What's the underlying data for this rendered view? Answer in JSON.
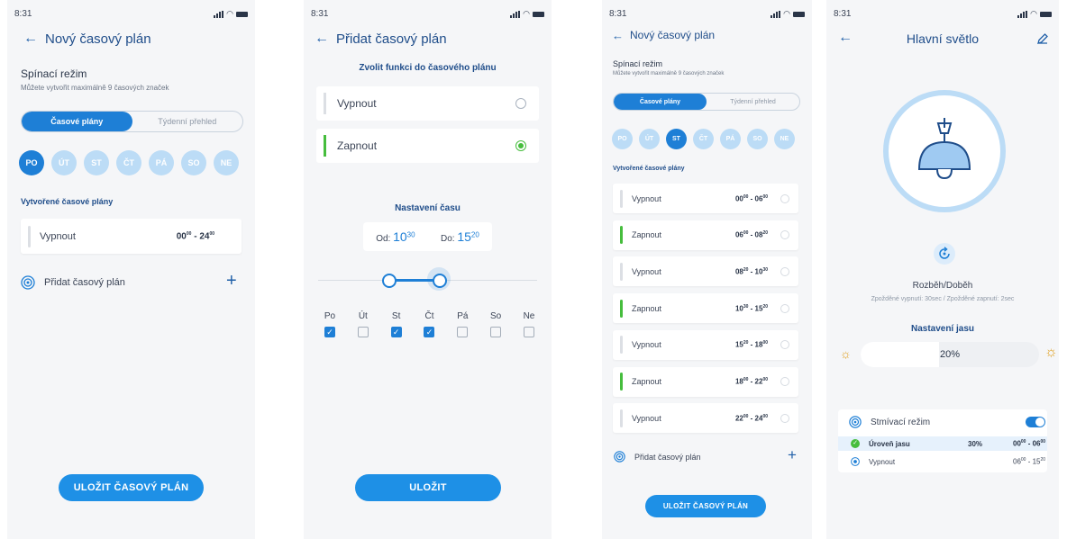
{
  "status": {
    "time": "8:31"
  },
  "colors": {
    "accent": "#1e7fd6",
    "green": "#46bd3d",
    "chip": "#bcdcf6"
  },
  "s1": {
    "title": "Nový časový plán",
    "mode_heading": "Spínací režim",
    "mode_sub": "Můžete vytvořit maximálně 9 časových značek",
    "seg": [
      "Časové plány",
      "Týdenní přehled"
    ],
    "days": [
      "PO",
      "ÚT",
      "ST",
      "ČT",
      "PÁ",
      "SO",
      "NE"
    ],
    "active_day": 0,
    "created_label": "Vytvořené časové plány",
    "plan": {
      "name": "Vypnout",
      "from": "00",
      "from_sup": "00",
      "to": "24",
      "to_sup": "00"
    },
    "add_label": "Přidat časový plán",
    "save": "ULOŽIT ČASOVÝ PLÁN"
  },
  "s2": {
    "title": "Přidat časový plán",
    "choose_label": "Zvolit funkci do časového plánu",
    "options": [
      {
        "label": "Vypnout",
        "selected": false
      },
      {
        "label": "Zapnout",
        "selected": true
      }
    ],
    "time_label": "Nastavení času",
    "from_label": "Od:",
    "from_h": "10",
    "from_m": "30",
    "to_label": "Do:",
    "to_h": "15",
    "to_m": "20",
    "days": [
      {
        "label": "Po",
        "checked": true
      },
      {
        "label": "Út",
        "checked": false
      },
      {
        "label": "St",
        "checked": true
      },
      {
        "label": "Čt",
        "checked": true
      },
      {
        "label": "Pá",
        "checked": false
      },
      {
        "label": "So",
        "checked": false
      },
      {
        "label": "Ne",
        "checked": false
      }
    ],
    "save": "ULOŽIT"
  },
  "s3": {
    "title": "Nový časový plán",
    "mode_heading": "Spínací režim",
    "mode_sub": "Můžete vytvořit maximálně 9 časových značek",
    "seg": [
      "Časové plány",
      "Týdenní přehled"
    ],
    "days": [
      "PO",
      "ÚT",
      "ST",
      "ČT",
      "PÁ",
      "SO",
      "NE"
    ],
    "active_day": 2,
    "created_label": "Vytvořené časové plány",
    "plans": [
      {
        "name": "Vypnout",
        "a": "00",
        "as": "00",
        "b": "06",
        "bs": "00",
        "green": false
      },
      {
        "name": "Zapnout",
        "a": "06",
        "as": "00",
        "b": "08",
        "bs": "20",
        "green": true
      },
      {
        "name": "Vypnout",
        "a": "08",
        "as": "20",
        "b": "10",
        "bs": "30",
        "green": false
      },
      {
        "name": "Zapnout",
        "a": "10",
        "as": "30",
        "b": "15",
        "bs": "20",
        "green": true
      },
      {
        "name": "Vypnout",
        "a": "15",
        "as": "20",
        "b": "18",
        "bs": "00",
        "green": false
      },
      {
        "name": "Zapnout",
        "a": "18",
        "as": "00",
        "b": "22",
        "bs": "00",
        "green": true
      },
      {
        "name": "Vypnout",
        "a": "22",
        "as": "00",
        "b": "24",
        "bs": "00",
        "green": false
      }
    ],
    "add_label": "Přidat časový plán",
    "save": "ULOŽIT ČASOVÝ PLÁN"
  },
  "s4": {
    "title": "Hlavní světlo",
    "ramp_label": "Rozběh/Doběh",
    "ramp_sub": "Zpožděné vypnutí: 30sec / Zpožděné zapnutí: 2sec",
    "brightness_label": "Nastavení jasu",
    "brightness_value": "20%",
    "brightness_fraction": 0.2,
    "dim_label": "Stmívací režim",
    "dim_on": true,
    "rows": [
      {
        "name": "Úroveň jasu",
        "pct": "30%",
        "a": "00",
        "as": "00",
        "b": "06",
        "bs": "00"
      },
      {
        "name": "Vypnout",
        "pct": "",
        "a": "06",
        "as": "00",
        "b": "15",
        "bs": "20"
      }
    ]
  }
}
